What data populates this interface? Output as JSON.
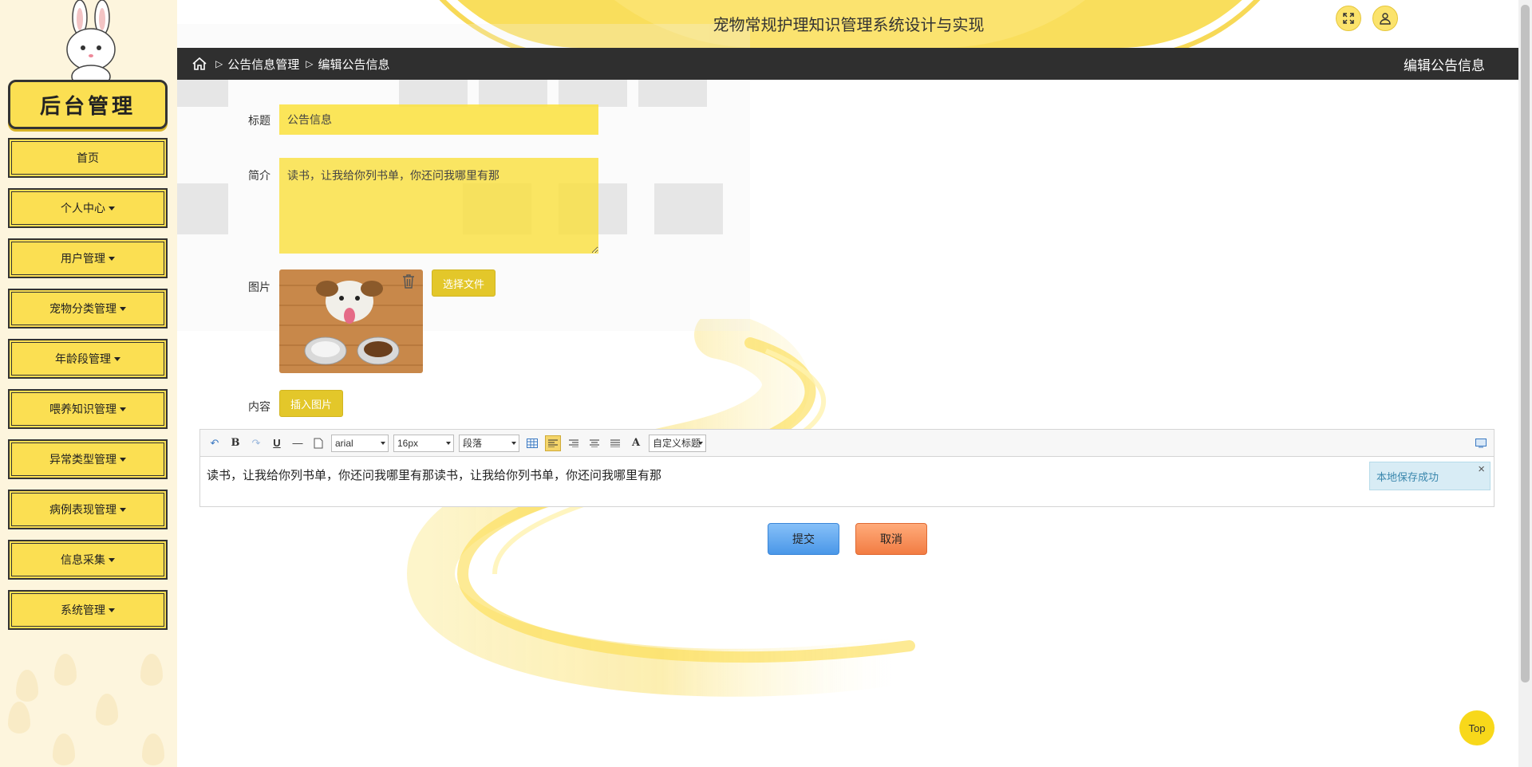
{
  "header": {
    "app_title": "宠物常规护理知识管理系统设计与实现"
  },
  "breadcrumb": {
    "items": [
      "公告信息管理",
      "编辑公告信息"
    ],
    "page_label": "编辑公告信息"
  },
  "sidebar": {
    "logo_text": "后台管理",
    "items": [
      {
        "label": "首页"
      },
      {
        "label": "个人中心"
      },
      {
        "label": "用户管理"
      },
      {
        "label": "宠物分类管理"
      },
      {
        "label": "年龄段管理"
      },
      {
        "label": "喂养知识管理"
      },
      {
        "label": "异常类型管理"
      },
      {
        "label": "病例表现管理"
      },
      {
        "label": "信息采集"
      },
      {
        "label": "系统管理"
      }
    ]
  },
  "form": {
    "title_label": "标题",
    "title_value": "公告信息",
    "intro_label": "简介",
    "intro_value": "读书，让我给你列书单，你还问我哪里有那",
    "image_label": "图片",
    "choose_file_label": "选择文件",
    "content_label": "内容",
    "insert_image_label": "插入图片"
  },
  "editor": {
    "font_family": "arial",
    "font_size": "16px",
    "paragraph": "段落",
    "custom_heading": "自定义标题",
    "content": "读书，让我给你列书单，你还问我哪里有那读书，让我给你列书单，你还问我哪里有那",
    "toast": "本地保存成功"
  },
  "actions": {
    "submit_label": "提交",
    "cancel_label": "取消",
    "top_label": "Top"
  },
  "colors": {
    "accent_yellow": "#fbdf52",
    "breadcrumb_bg": "#2f2f2f",
    "submit_blue": "#4a97e8",
    "cancel_orange": "#f27c43"
  }
}
